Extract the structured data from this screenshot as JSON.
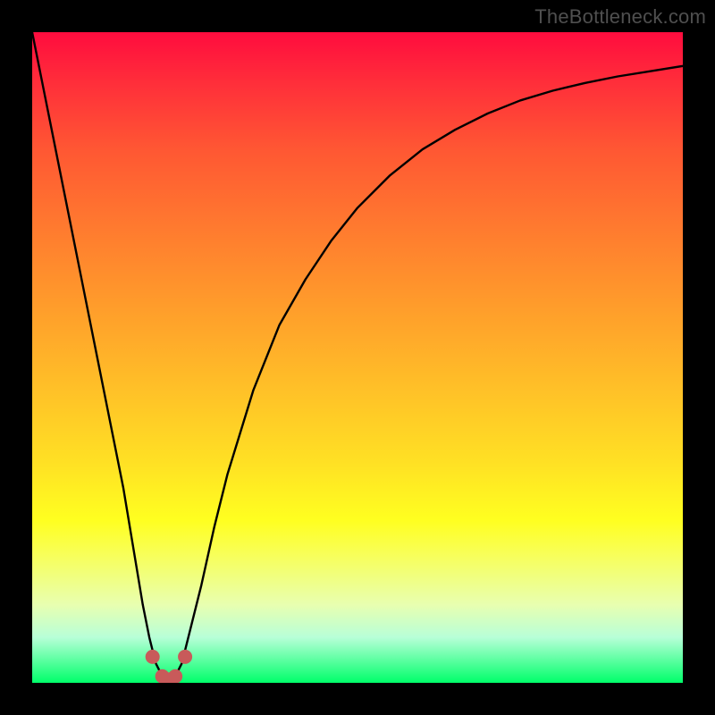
{
  "watermark": "TheBottleneck.com",
  "chart_data": {
    "type": "line",
    "title": "",
    "xlabel": "",
    "ylabel": "",
    "xlim": [
      0,
      100
    ],
    "ylim": [
      0,
      100
    ],
    "grid": false,
    "legend": false,
    "x": [
      0,
      2,
      4,
      6,
      8,
      10,
      12,
      14,
      16,
      17,
      18,
      19,
      20,
      21,
      22,
      23,
      24,
      26,
      28,
      30,
      34,
      38,
      42,
      46,
      50,
      55,
      60,
      65,
      70,
      75,
      80,
      85,
      90,
      95,
      100
    ],
    "values": [
      100,
      90,
      80,
      70,
      60,
      50,
      40,
      30,
      18,
      12,
      7,
      3,
      1,
      0.5,
      1,
      3,
      7,
      15,
      24,
      32,
      45,
      55,
      62,
      68,
      73,
      78,
      82,
      85,
      87.5,
      89.5,
      91,
      92.2,
      93.2,
      94,
      94.8
    ],
    "markers": {
      "color": "#c85a5a",
      "points": [
        {
          "x": 18.5,
          "y": 4
        },
        {
          "x": 20.0,
          "y": 1
        },
        {
          "x": 21.0,
          "y": 0.5
        },
        {
          "x": 22.0,
          "y": 1
        },
        {
          "x": 23.5,
          "y": 4
        }
      ]
    }
  }
}
